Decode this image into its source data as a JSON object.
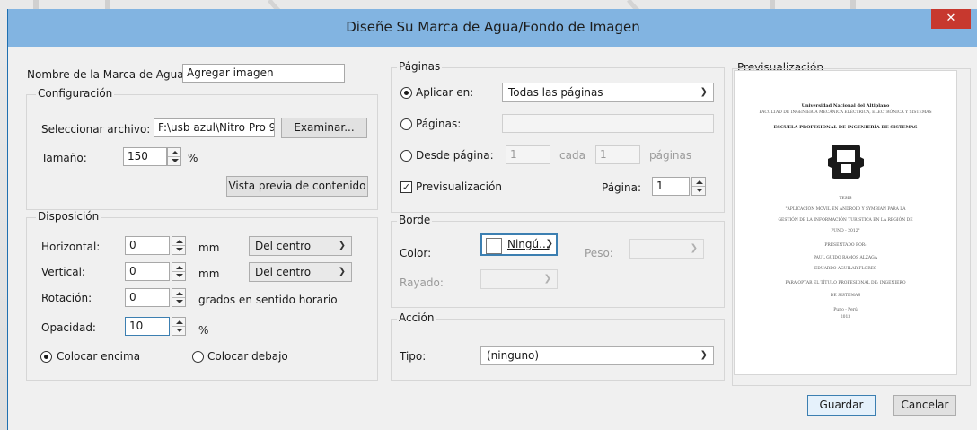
{
  "window": {
    "title": "Diseñe Su Marca de Agua/Fondo de Imagen",
    "close_glyph": "✕"
  },
  "watermark_name": {
    "label": "Nombre de la Marca de Agua:",
    "value": "Agregar imagen"
  },
  "config": {
    "title": "Configuración",
    "file_label": "Seleccionar archivo:",
    "file_value": "F:\\usb azul\\Nitro Pro 9",
    "browse_label": "Examinar...",
    "size_label": "Tamaño:",
    "size_value": "150",
    "size_unit": "%",
    "preview_content_label": "Vista previa de contenido"
  },
  "layout": {
    "title": "Disposición",
    "horizontal_label": "Horizontal:",
    "horizontal_value": "0",
    "horizontal_unit": "mm",
    "horizontal_origin": "Del centro",
    "vertical_label": "Vertical:",
    "vertical_value": "0",
    "vertical_unit": "mm",
    "vertical_origin": "Del centro",
    "rotation_label": "Rotación:",
    "rotation_value": "0",
    "rotation_unit": "grados en sentido horario",
    "opacity_label": "Opacidad:",
    "opacity_value": "10",
    "opacity_unit": "%",
    "place_above_label": "Colocar encima",
    "place_below_label": "Colocar debajo"
  },
  "pages": {
    "title": "Páginas",
    "apply_label": "Aplicar en:",
    "apply_value": "Todas las páginas",
    "pages_label": "Páginas:",
    "pages_value": "",
    "from_label": "Desde página:",
    "from_value": "1",
    "every_label": "cada",
    "every_value": "1",
    "pages_suffix": "páginas",
    "preview_label": "Previsualización",
    "page_label": "Página:",
    "page_value": "1"
  },
  "border": {
    "title": "Borde",
    "color_label": "Color:",
    "color_value": "Ningú...",
    "weight_label": "Peso:",
    "weight_value": "",
    "dash_label": "Rayado:",
    "dash_value": ""
  },
  "action": {
    "title": "Acción",
    "type_label": "Tipo:",
    "type_value": "(ninguno)"
  },
  "preview": {
    "title": "Previsualización",
    "lines": [
      "Universidad Nacional del Altiplano",
      "FACULTAD DE INGENIERÍA MECÁNICA ELÉCTRICA, ELECTRÓNICA Y SISTEMAS",
      "ESCUELA PROFESIONAL DE INGENIERÍA DE SISTEMAS",
      "TESIS",
      "\"APLICACIÓN MÓVIL EN ANDROID Y SYMBIAN PARA LA",
      "GESTIÓN DE LA INFORMACIÓN TURÍSTICA EN LA REGIÓN DE",
      "PUNO - 2012\"",
      "PRESENTADO POR:",
      "PAUL GUIDO RAMOS ALZAGA",
      "EDUARDO AGUILAR FLORES",
      "PARA OPTAR EL TÍTULO PROFESIONAL DE: INGENIERO",
      "DE SISTEMAS",
      "Puno - Perú",
      "2013"
    ]
  },
  "footer": {
    "save_label": "Guardar",
    "cancel_label": "Cancelar"
  },
  "colors": {
    "accent": "#2884d6",
    "close": "#c7382e",
    "default_button": "#3c7fb1"
  }
}
